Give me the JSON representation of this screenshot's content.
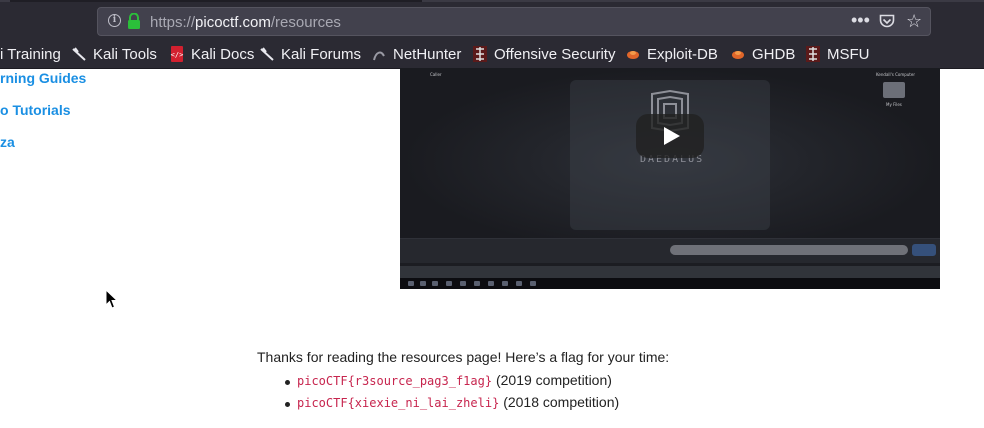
{
  "browser": {
    "url_scheme": "https://",
    "url_host": "picoctf.com",
    "url_path": "/resources",
    "page_actions_glyph": "•••",
    "bookmark_star_glyph": "☆"
  },
  "bookmarks": [
    {
      "label": "i Training",
      "icon": "kali-dragon-icon"
    },
    {
      "label": "Kali Tools",
      "icon": "kali-dragon-icon"
    },
    {
      "label": "Kali Docs",
      "icon": "kali-docs-icon"
    },
    {
      "label": "Kali Forums",
      "icon": "kali-dragon-icon"
    },
    {
      "label": "NetHunter",
      "icon": "nethunter-icon"
    },
    {
      "label": "Offensive Security",
      "icon": "offsec-icon"
    },
    {
      "label": "Exploit-DB",
      "icon": "exploitdb-icon"
    },
    {
      "label": "GHDB",
      "icon": "exploitdb-icon"
    },
    {
      "label": "MSFU",
      "icon": "offsec-icon"
    }
  ],
  "sidebar": {
    "links": [
      "rning Guides",
      "o Tutorials",
      "za"
    ]
  },
  "video": {
    "logo_text": "DAEDALUS",
    "desktop_label_left": "Caller",
    "desktop_label_right": "Kendall's Computer",
    "folder_label": "My Files"
  },
  "main": {
    "flag_intro": "Thanks for reading the resources page! Here’s a flag for your time:",
    "flags": [
      {
        "code": "picoCTF{r3source_pag3_f1ag}",
        "note": "(2019 competition)"
      },
      {
        "code": "picoCTF{xiexie_ni_lai_zheli}",
        "note": "(2018 competition)"
      }
    ]
  }
}
